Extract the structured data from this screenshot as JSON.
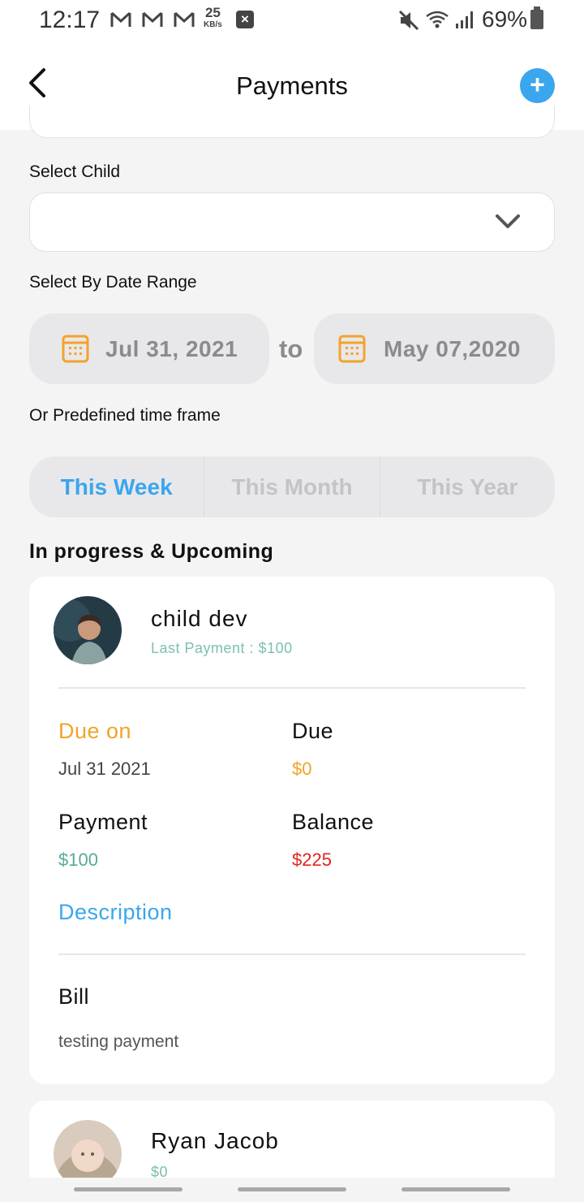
{
  "status_bar": {
    "time": "12:17",
    "speed_value": "25",
    "speed_unit": "KB/s",
    "battery": "69%"
  },
  "header": {
    "title": "Payments",
    "back_icon": "chevron-left-icon",
    "add_icon": "plus-icon",
    "add_label": "+"
  },
  "filters": {
    "select_child_label": "Select Child",
    "select_child_value": "",
    "date_range_label": "Select By Date Range",
    "date_from": "Jul 31, 2021",
    "date_to": "May 07,2020",
    "to_label": "to",
    "predefined_label": "Or Predefined time frame",
    "timeframes": [
      "This Week",
      "This Month",
      "This Year"
    ],
    "active_timeframe": "This Week"
  },
  "section_title": "In progress & Upcoming",
  "cards": [
    {
      "name": "child dev",
      "last_payment": "Last Payment : $100",
      "due_on_label": "Due on",
      "due_on_value": "Jul 31 2021",
      "due_label": "Due",
      "due_value": "$0",
      "payment_label": "Payment",
      "payment_value": "$100",
      "balance_label": "Balance",
      "balance_value": "$225",
      "description_label": "Description",
      "bill_label": "Bill",
      "bill_text": "testing payment"
    },
    {
      "name": "Ryan Jacob",
      "last_payment": "$0"
    }
  ],
  "colors": {
    "accent_blue": "#3aa6ee",
    "orange": "#f0a428",
    "teal": "#5aa89a",
    "red": "#e0261e",
    "calendar_orange": "#f3a32b"
  }
}
